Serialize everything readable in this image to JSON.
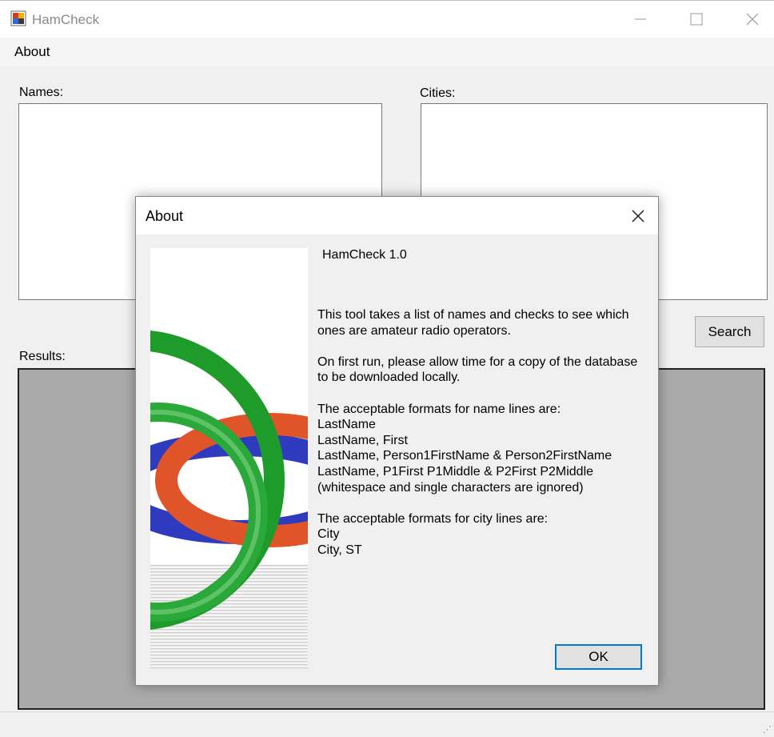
{
  "window": {
    "title": "HamCheck",
    "menu": {
      "about_label": "About"
    }
  },
  "form": {
    "names_label": "Names:",
    "names_value": "",
    "cities_label": "Cities:",
    "cities_value": "",
    "search_label": "Search",
    "results_label": "Results:"
  },
  "about_dialog": {
    "title": "About",
    "app_version": "HamCheck 1.0",
    "description_lines": [
      "This tool takes a list of names and checks to see which",
      "ones are amateur radio operators.",
      "",
      "On first run, please allow time for a copy of the database",
      "to be downloaded locally.",
      "",
      "The acceptable formats for name lines are:",
      "LastName",
      "LastName, First",
      "LastName, Person1FirstName & Person2FirstName",
      "LastName, P1First P1Middle & P2First P2Middle",
      "(whitespace and single characters are ignored)",
      "",
      "The acceptable formats for city lines are:",
      "City",
      "City, ST"
    ],
    "ok_label": "OK"
  },
  "colors": {
    "accent": "#0078d7",
    "results_background": "#aaaaaa",
    "ring_green": "#1e9b2a",
    "ring_orange": "#e0542a",
    "ring_blue": "#2e3bbf"
  },
  "icons": [
    "app-icon",
    "minimize-icon",
    "maximize-icon",
    "close-icon",
    "dialog-close-icon",
    "size-grip-icon"
  ]
}
